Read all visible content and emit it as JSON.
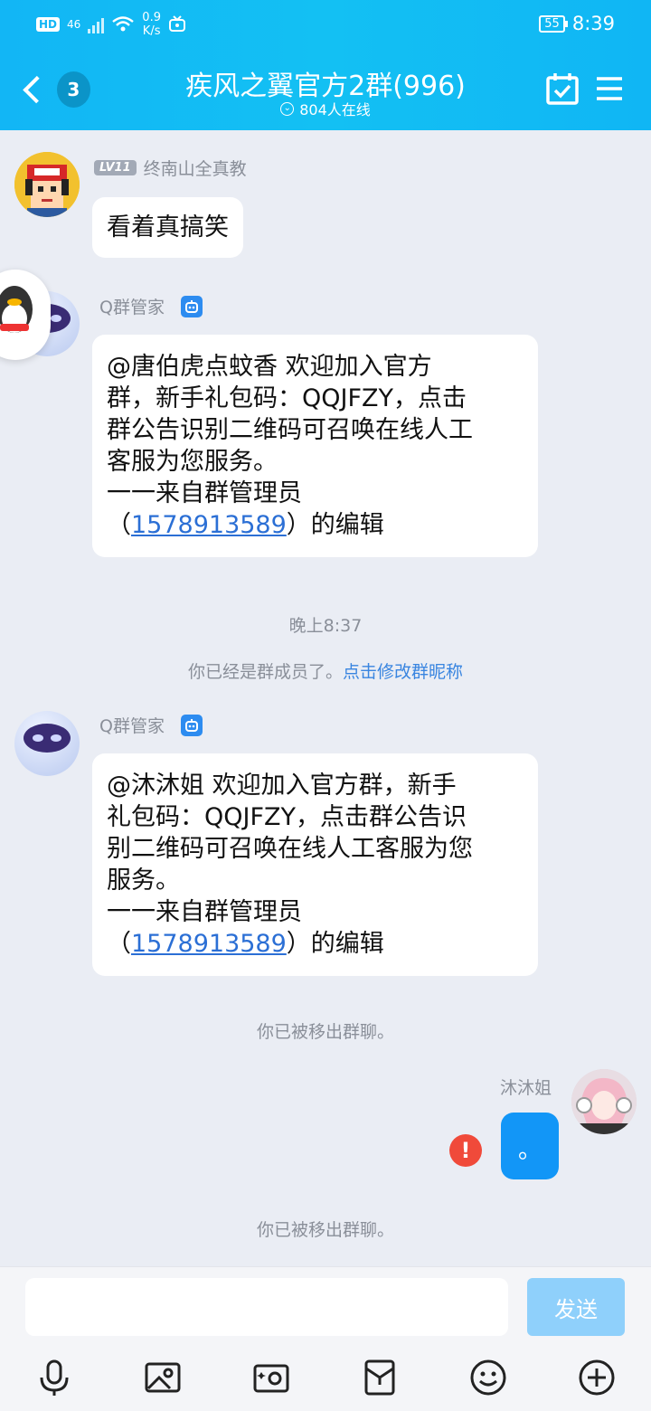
{
  "statusbar": {
    "hd": "HD",
    "network": "46",
    "speed_value": "0.9",
    "speed_unit": "K/s",
    "battery": "55",
    "time": "8:39"
  },
  "header": {
    "back_count": "3",
    "title": "疾风之翼官方2群(996)",
    "online": "804人在线",
    "accent": "#12b6f5"
  },
  "messages": [
    {
      "level": "LV11",
      "sender": "终南山全真教",
      "text": "看着真搞笑"
    },
    {
      "sender": "Q群管家",
      "lines": [
        "@唐伯虎点蚊香 欢迎加入官方",
        "群，新手礼包码：QQJFZY，点击",
        "群公告识别二维码可召唤在线人工",
        "客服为您服务。",
        "一一来自群管理员"
      ],
      "link_prefix": "（",
      "link": "1578913589",
      "link_suffix": "）的编辑"
    },
    {
      "sender": "Q群管家",
      "lines": [
        "@沐沐姐 欢迎加入官方群，新手",
        "礼包码：QQJFZY，点击群公告识",
        "别二维码可召唤在线人工客服为您",
        "服务。",
        "一一来自群管理员"
      ],
      "link_prefix": "（",
      "link": "1578913589",
      "link_suffix": "）的编辑"
    }
  ],
  "system": {
    "time": "晚上8:37",
    "member_text": "你已经是群成员了。",
    "member_link": "点击修改群昵称",
    "removed_1": "你已被移出群聊。",
    "removed_2": "你已被移出群聊。"
  },
  "me": {
    "name": "沐沐姐",
    "text": "。",
    "error_mark": "!"
  },
  "input": {
    "placeholder": "",
    "send_label": "发送"
  },
  "icons": [
    "back-icon",
    "calendar-check-icon",
    "menu-icon",
    "microphone-icon",
    "image-icon",
    "camera-icon",
    "red-packet-icon",
    "emoji-icon",
    "plus-icon"
  ]
}
